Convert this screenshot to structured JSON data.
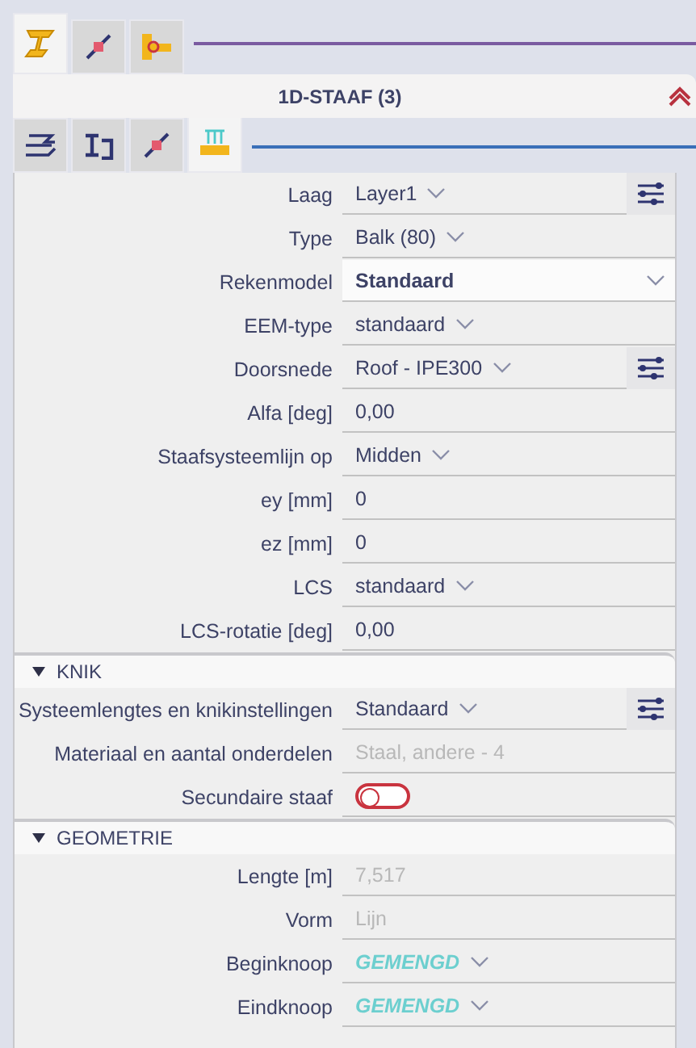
{
  "top_tabs": [
    {
      "selected": true
    },
    {
      "selected": false
    },
    {
      "selected": false
    }
  ],
  "panel_title": "1D-STAAF (3)",
  "sub_tabs": [
    {
      "selected": false
    },
    {
      "selected": false
    },
    {
      "selected": false
    },
    {
      "selected": true
    }
  ],
  "sections": [
    {
      "rows": [
        {
          "label": "Laag",
          "kind": "dropdown",
          "value": "Layer1",
          "settings": true
        },
        {
          "label": "Type",
          "kind": "dropdown",
          "value": "Balk (80)"
        },
        {
          "label": "Rekenmodel",
          "kind": "combo",
          "value": "Standaard"
        },
        {
          "label": "EEM-type",
          "kind": "dropdown",
          "value": "standaard"
        },
        {
          "label": "Doorsnede",
          "kind": "dropdown",
          "value": "Roof - IPE300",
          "settings": true
        },
        {
          "label": "Alfa [deg]",
          "kind": "text",
          "value": "0,00"
        },
        {
          "label": "Staafsysteemlijn op",
          "kind": "dropdown",
          "value": "Midden"
        },
        {
          "label": "ey [mm]",
          "kind": "text",
          "value": "0"
        },
        {
          "label": "ez [mm]",
          "kind": "text",
          "value": "0"
        },
        {
          "label": "LCS",
          "kind": "dropdown",
          "value": "standaard"
        },
        {
          "label": "LCS-rotatie [deg]",
          "kind": "text",
          "value": "0,00"
        }
      ]
    },
    {
      "title": "KNIK",
      "expanded": true,
      "rows": [
        {
          "label": "Systeemlengtes en knikinstellingen",
          "kind": "dropdown",
          "value": "Standaard",
          "settings": true
        },
        {
          "label": "Materiaal en aantal onderdelen",
          "kind": "text",
          "value": "Staal, andere - 4",
          "disabled": true
        },
        {
          "label": "Secundaire staaf",
          "kind": "toggle",
          "on": false
        }
      ]
    },
    {
      "title": "GEOMETRIE",
      "expanded": true,
      "rows": [
        {
          "label": "Lengte [m]",
          "kind": "text",
          "value": "7,517",
          "disabled": true
        },
        {
          "label": "Vorm",
          "kind": "text",
          "value": "Lijn",
          "disabled": true
        },
        {
          "label": "Beginknoop",
          "kind": "dropdown",
          "value": "GEMENGD",
          "mixed": true
        },
        {
          "label": "Eindknoop",
          "kind": "dropdown",
          "value": "GEMENGD",
          "mixed": true
        }
      ]
    }
  ]
}
